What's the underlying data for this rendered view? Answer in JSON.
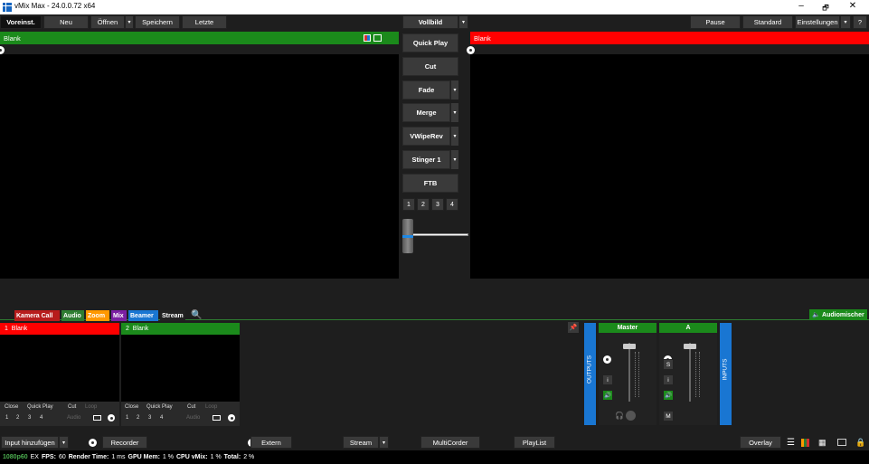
{
  "window": {
    "title": "vMix Max - 24.0.0.72 x64",
    "min": "–",
    "restore": "🗗",
    "close": "✕"
  },
  "menu": {
    "preset": "Voreinst.",
    "new": "Neu",
    "open": "Öffnen",
    "open_arrow": "▾",
    "save": "Speichern",
    "recent": "Letzte",
    "fullscreen": "Vollbild",
    "fullscreen_arrow": "▾",
    "pause": "Pause",
    "standard": "Standard",
    "settings": "Einstellungen",
    "settings_arrow": "▾",
    "help": "?"
  },
  "preview": {
    "label": "Blank"
  },
  "output": {
    "label": "Blank"
  },
  "transitions": {
    "quick_play": "Quick Play",
    "cut": "Cut",
    "fade": "Fade",
    "merge": "Merge",
    "wipe": "VWipeRev",
    "stinger": "Stinger 1",
    "ftb": "FTB",
    "arrow": "▾",
    "numbers": [
      "1",
      "2",
      "3",
      "4"
    ],
    "tbar_level": 0.12
  },
  "tabs": [
    {
      "label": "Kamera Call",
      "color": "#b71c1c"
    },
    {
      "label": "Audio",
      "color": "#2e7d32"
    },
    {
      "label": "Zoom",
      "color": "#ff9800"
    },
    {
      "label": "Mix",
      "color": "#7b1fa2"
    },
    {
      "label": "Beamer",
      "color": "#1976d2"
    },
    {
      "label": "Stream",
      "color": "#212121"
    }
  ],
  "audiomixer_label": "Audiomischer",
  "inputs": [
    {
      "number": "1",
      "name": "Blank",
      "color": "#ff0000",
      "close": "Close",
      "quickplay": "Quick Play",
      "cut": "Cut",
      "loop": "Loop",
      "nums": [
        "1",
        "2",
        "3",
        "4"
      ],
      "audio": "Audio"
    },
    {
      "number": "2",
      "name": "Blank",
      "color": "#1b8a1b",
      "close": "Close",
      "quickplay": "Quick Play",
      "cut": "Cut",
      "loop": "Loop",
      "nums": [
        "1",
        "2",
        "3",
        "4"
      ],
      "audio": "Audio"
    }
  ],
  "mixer": {
    "outputs": "OUTPUTS",
    "inputs": "INPUTS",
    "master": "Master",
    "a": "A",
    "i": "i",
    "s": "S",
    "m": "M"
  },
  "bottom": {
    "add_input": "Input hinzufügen",
    "add_arrow": "▾",
    "recorder": "Recorder",
    "external": "Extern",
    "stream": "Stream",
    "stream_arrow": "▾",
    "multicorder": "MultiCorder",
    "playlist": "PlayList",
    "overlay": "Overlay"
  },
  "status": {
    "format": "1080p60",
    "ex": "EX",
    "fps_label": "FPS:",
    "fps": "60",
    "render_label": "Render Time:",
    "render": "1 ms",
    "gpu_label": "GPU Mem:",
    "gpu": "1 %",
    "cpu_label": "CPU vMix:",
    "cpu": "1 %",
    "total_label": "Total:",
    "total": "2 %"
  }
}
